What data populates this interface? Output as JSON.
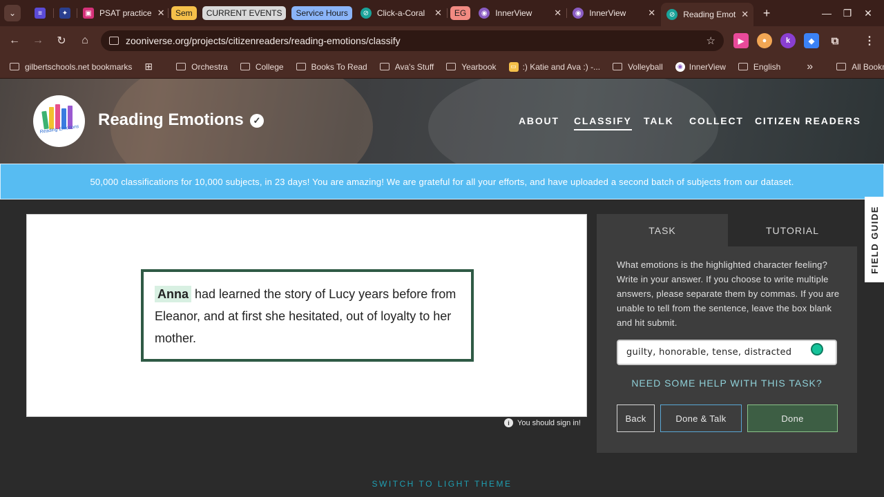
{
  "browser": {
    "tabs": [
      {
        "label": "",
        "kind": "icon",
        "color": "#5b4bd6"
      },
      {
        "label": "",
        "kind": "icon",
        "color": "#2a3f8f"
      },
      {
        "label": "PSAT practice",
        "color": "#d6327a"
      },
      {
        "label": "Sem",
        "kind": "chip",
        "color": "#f5c04a"
      },
      {
        "label": "CURRENT EVENTS",
        "kind": "chip",
        "color": "#d9d9d9"
      },
      {
        "label": "Service Hours",
        "kind": "chip",
        "color": "#8ab4f8"
      },
      {
        "label": "Click-a-Coral",
        "color": "#1aa39a"
      },
      {
        "label": "EG",
        "kind": "chip",
        "color": "#f28b82"
      },
      {
        "label": "InnerView",
        "color": "#8a5cc2"
      },
      {
        "label": "InnerView",
        "color": "#8a5cc2"
      },
      {
        "label": "Reading Emot",
        "color": "#1aa39a",
        "active": true
      }
    ],
    "new_tab": "+",
    "url": "zooniverse.org/projects/citizenreaders/reading-emotions/classify",
    "bookmarks": [
      {
        "label": "gilbertschools.net bookmarks",
        "icon": "link-folder-icon"
      },
      {
        "label": "",
        "icon": "apps-grid-icon"
      },
      {
        "label": "Orchestra",
        "icon": "folder-icon"
      },
      {
        "label": "College",
        "icon": "folder-icon"
      },
      {
        "label": "Books To Read",
        "icon": "folder-icon"
      },
      {
        "label": "Ava's Stuff",
        "icon": "folder-icon"
      },
      {
        "label": "Yearbook",
        "icon": "folder-icon"
      },
      {
        "label": ":) Katie and Ava :) -...",
        "icon": "slides-icon"
      },
      {
        "label": "Volleyball",
        "icon": "folder-icon"
      },
      {
        "label": "InnerView",
        "icon": "innerview-icon"
      },
      {
        "label": "English",
        "icon": "folder-icon"
      }
    ],
    "more_bookmarks": "»",
    "all_bookmarks": "All Bookmarks"
  },
  "project": {
    "title": "Reading Emotions",
    "logo_text": "Reading Emotions",
    "nav": [
      "ABOUT",
      "CLASSIFY",
      "TALK",
      "COLLECT",
      "CITIZEN READERS"
    ],
    "active_nav": "CLASSIFY"
  },
  "banner": "50,000 classifications for 10,000 subjects, in 23 days! You are amazing! We are grateful for all your efforts, and have uploaded a second batch of subjects from our dataset.",
  "subject": {
    "character": "Anna",
    "text": "had learned the story of Lucy years before from Eleanor, and at first she hesitated, out of loyalty to her mother.",
    "sign_in": "You should sign in!"
  },
  "task": {
    "tab_task": "TASK",
    "tab_tutorial": "TUTORIAL",
    "question": "What emotions is the highlighted character feeling? Write in your answer. If you choose to write multiple answers, please separate them by commas. If you are unable to tell from the sentence, leave the box blank and hit submit.",
    "answer": "guilty, honorable, tense, distracted",
    "help": "NEED SOME HELP WITH THIS TASK?",
    "back": "Back",
    "done_talk": "Done & Talk",
    "done": "Done"
  },
  "field_guide": "FIELD GUIDE",
  "theme_switch": "SWITCH TO LIGHT THEME",
  "colors": {
    "banner": "#57bcf2",
    "done_button": "#3d5e44",
    "textbox_border": "#2f5a45",
    "highlight": "#d8f0e2"
  }
}
